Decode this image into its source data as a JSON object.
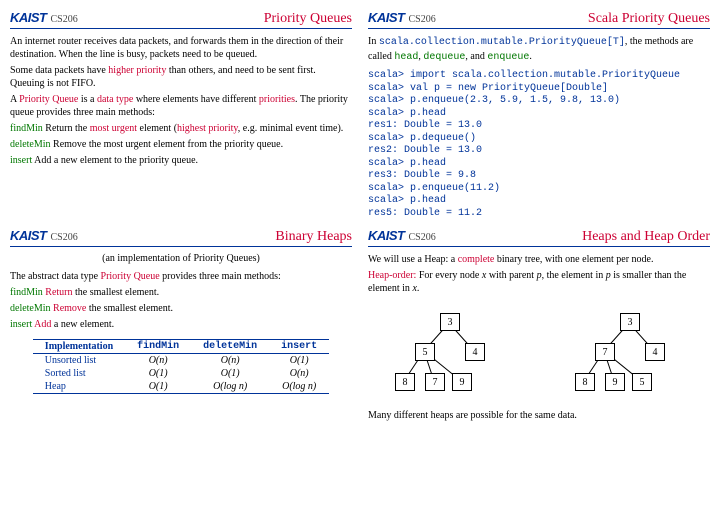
{
  "course": "CS206",
  "logo": "KAIST",
  "slides": {
    "pq": {
      "title": "Priority Queues",
      "p1a": "An internet router receives data packets, and forwards them in the direction of their destination. When the line is busy, packets need to be queued.",
      "p2a": "Some data packets have ",
      "p2b": "higher priority",
      "p2c": " than others, and need to be sent first. Queuing is not FIFO.",
      "p3a": "A ",
      "p3b": "Priority Queue",
      "p3c": " is a ",
      "p3d": "data type",
      "p3e": " where elements have different ",
      "p3f": "priorities",
      "p3g": ". The priority queue provides three main methods:",
      "m1k": "findMin",
      "m1v1": " Return the ",
      "m1v2": "most urgent",
      "m1v3": " element (",
      "m1v4": "highest priority",
      "m1v5": ", e.g. minimal event time).",
      "m2k": "deleteMin",
      "m2v": " Remove the most urgent element from the priority queue.",
      "m3k": "insert",
      "m3v": " Add a new element to the priority queue."
    },
    "scala": {
      "title": "Scala Priority Queues",
      "intro1": "In ",
      "intro2": "scala.collection.mutable.PriorityQueue[T]",
      "intro3": ", the methods are called ",
      "intro4": "head",
      "intro5": ", ",
      "intro6": "dequeue",
      "intro7": ", and ",
      "intro8": "enqueue",
      "intro9": ".",
      "code": "scala> import scala.collection.mutable.PriorityQueue\nscala> val p = new PriorityQueue[Double]\nscala> p.enqueue(2.3, 5.9, 1.5, 9.8, 13.0)\nscala> p.head\nres1: Double = 13.0\nscala> p.dequeue()\nres2: Double = 13.0\nscala> p.head\nres3: Double = 9.8\nscala> p.enqueue(11.2)\nscala> p.head\nres5: Double = 11.2"
    },
    "bh": {
      "title": "Binary Heaps",
      "sub": "(an implementation of Priority Queues)",
      "p1a": "The abstract data type ",
      "p1b": "Priority Queue",
      "p1c": " provides three main methods:",
      "m1k": "findMin",
      "m1v": "Return",
      "m1w": " the smallest element.",
      "m2k": "deleteMin",
      "m2v": "Remove",
      "m2w": " the smallest element.",
      "m3k": "insert",
      "m3v": "Add",
      "m3w": " a new element.",
      "th1": "Implementation",
      "th2": "findMin",
      "th3": "deleteMin",
      "th4": "insert",
      "r1": "Unsorted list",
      "r1a": "O(n)",
      "r1b": "O(n)",
      "r1c": "O(1)",
      "r2": "Sorted list",
      "r2a": "O(1)",
      "r2b": "O(1)",
      "r2c": "O(n)",
      "r3": "Heap",
      "r3a": "O(1)",
      "r3b": "O(log n)",
      "r3c": "O(log n)"
    },
    "ho": {
      "title": "Heaps and Heap Order",
      "p1a": "We will use a Heap: a ",
      "p1b": "complete",
      "p1c": " binary tree, with one element per node.",
      "p2a": "Heap-order:",
      "p2b": " For every node ",
      "p2c": "x",
      "p2d": " with parent ",
      "p2e": "p",
      "p2f": ", the element in ",
      "p2g": "p",
      "p2h": " is smaller than the element in ",
      "p2i": "x",
      "p2j": ".",
      "tree1": [
        "3",
        "5",
        "4",
        "8",
        "7",
        "9"
      ],
      "tree2": [
        "3",
        "7",
        "4",
        "8",
        "9",
        "5"
      ],
      "foot": "Many different heaps are possible for the same data."
    }
  }
}
